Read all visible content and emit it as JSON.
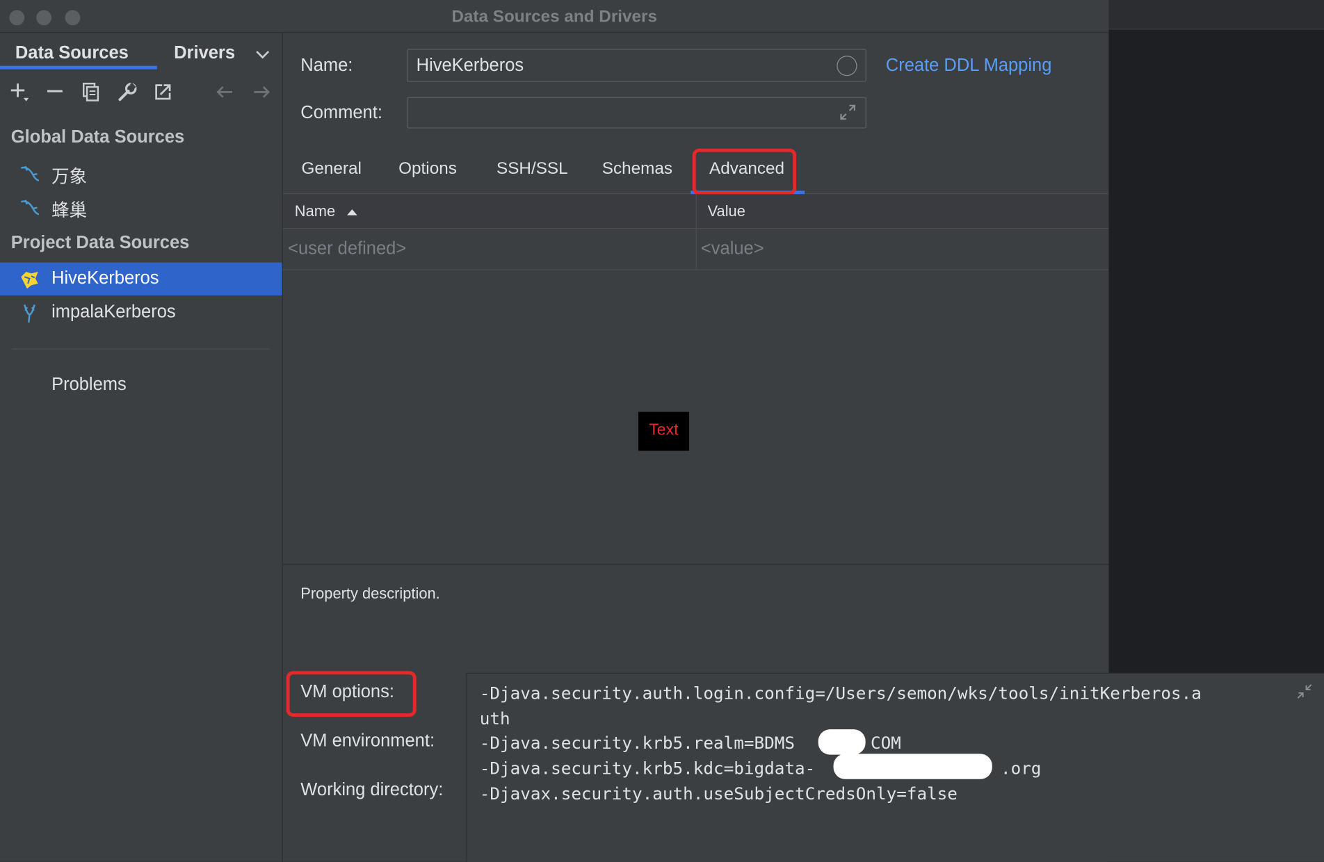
{
  "window": {
    "title": "Data Sources and Drivers"
  },
  "left_panel": {
    "tabs": [
      "Data Sources",
      "Drivers"
    ],
    "sections": {
      "global_title": "Global Data Sources",
      "global_items": [
        "万象",
        "蜂巢"
      ],
      "project_title": "Project Data Sources",
      "project_items": [
        "HiveKerberos",
        "impalaKerberos"
      ],
      "selected": "HiveKerberos"
    },
    "problems_label": "Problems",
    "toolbar_icons": [
      "add-icon",
      "remove-icon",
      "copy-icon",
      "wrench-icon",
      "external-link-icon",
      "back-arrow-icon",
      "forward-arrow-icon"
    ]
  },
  "form": {
    "name_label": "Name:",
    "name_value": "HiveKerberos",
    "comment_label": "Comment:",
    "comment_value": "",
    "ddl_link": "Create DDL Mapping"
  },
  "tabs": {
    "items": [
      "General",
      "Options",
      "SSH/SSL",
      "Schemas",
      "Advanced"
    ],
    "active": "Advanced"
  },
  "table": {
    "col_name": "Name",
    "col_value": "Value",
    "placeholder_name": "<user defined>",
    "placeholder_value": "<value>"
  },
  "overlay_badge": "Text",
  "description": "Property description.",
  "vm": {
    "options_label": "VM options:",
    "environment_label": "VM environment:",
    "workdir_label": "Working directory:",
    "lines": [
      "-Djava.security.auth.login.config=/Users/semon/wks/tools/initKerberos.a",
      "uth",
      "-Djava.security.krb5.realm=BDMS",
      "COM",
      "-Djava.security.krb5.kdc=bigdata-",
      ".org",
      "-Djavax.security.auth.useSubjectCredsOnly=false"
    ]
  },
  "colors": {
    "accent": "#3574f0",
    "selection": "#2f65ca",
    "highlight": "#e5292a",
    "link": "#589df6"
  }
}
